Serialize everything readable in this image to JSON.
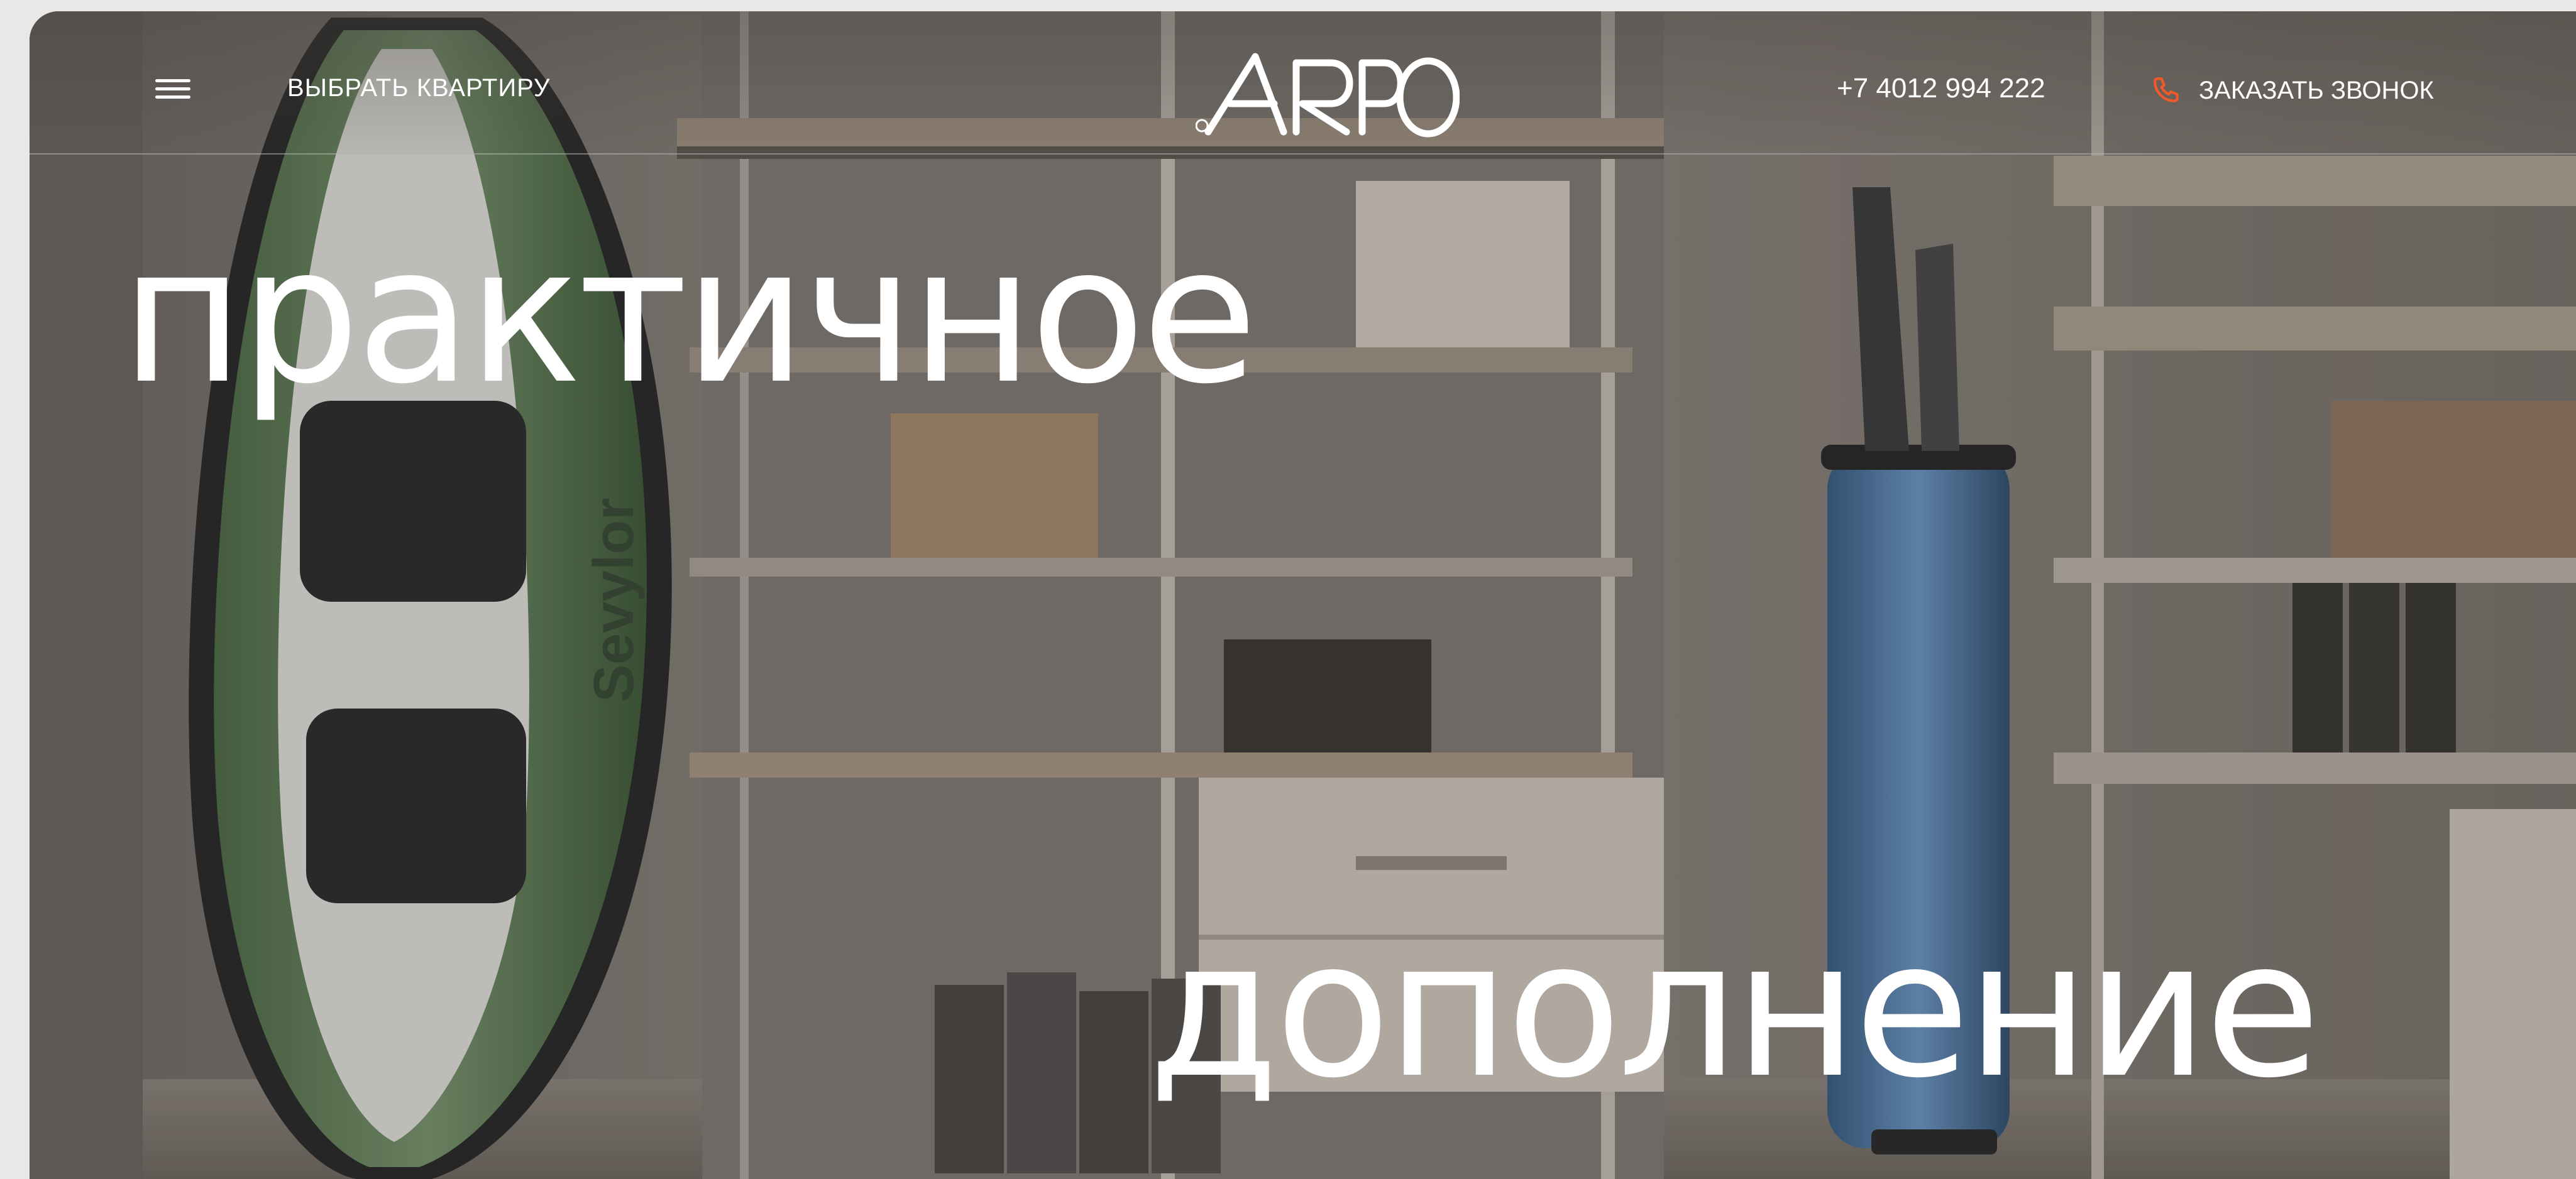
{
  "header": {
    "menu_icon": "hamburger-menu-icon",
    "select_apartment_label": "ВЫБРАТЬ КВАРТИРУ",
    "logo_text": "ARPO",
    "phone": "+7 4012 994 222",
    "callback_icon": "phone-icon",
    "callback_label": "ЗАКАЗАТЬ ЗВОНОК"
  },
  "hero": {
    "headline_line1": "практичное",
    "headline_line2": "дополнение"
  },
  "colors": {
    "accent": "#f0592a",
    "text": "#ffffff",
    "overlay": "#7d766f"
  }
}
